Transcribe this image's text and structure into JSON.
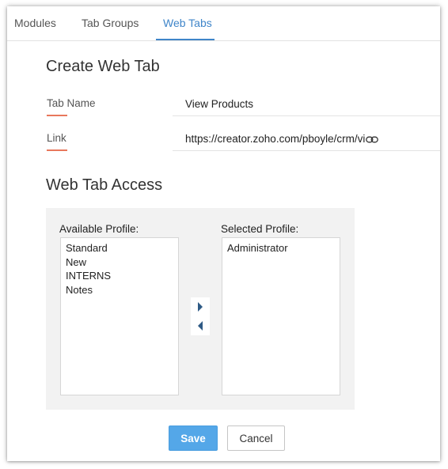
{
  "tabs": [
    {
      "label": "Modules"
    },
    {
      "label": "Tab Groups"
    },
    {
      "label": "Web Tabs"
    }
  ],
  "active_tab": "Web Tabs",
  "form": {
    "title": "Create Web Tab",
    "tab_name_label": "Tab Name",
    "tab_name_value": "View Products",
    "link_label": "Link",
    "link_value": "https://creator.zoho.com/pboyle/crm/vi"
  },
  "access": {
    "title": "Web Tab Access",
    "available_label": "Available Profile:",
    "available_profiles": [
      "Standard",
      "New",
      "INTERNS",
      "Notes"
    ],
    "selected_label": "Selected Profile:",
    "selected_profiles": [
      "Administrator"
    ]
  },
  "buttons": {
    "save": "Save",
    "cancel": "Cancel"
  },
  "colors": {
    "accent": "#3f85c9",
    "field_marker": "#e8775c",
    "primary_button": "#54a7e8"
  },
  "icons": {
    "link": "link-icon",
    "move_right": "caret-right-icon",
    "move_left": "caret-left-icon"
  }
}
